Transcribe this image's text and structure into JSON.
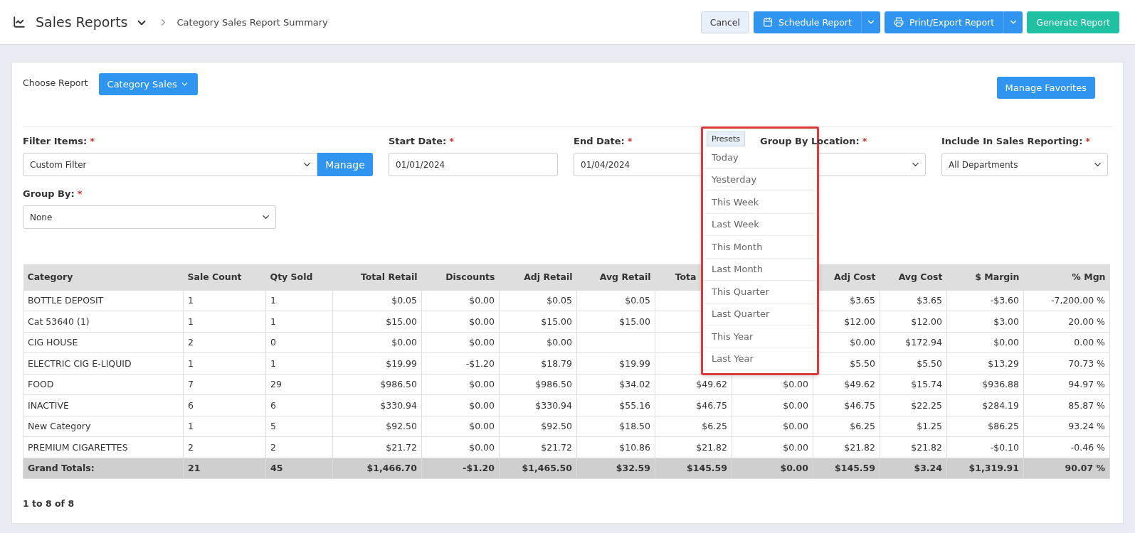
{
  "header": {
    "title": "Sales Reports",
    "breadcrumb": "Category Sales Report Summary",
    "cancel_button": "Cancel",
    "schedule_button": "Schedule Report",
    "export_button": "Print/Export Report",
    "generate_button": "Generate Report"
  },
  "choose_report": {
    "label": "Choose Report",
    "value": "Category Sales",
    "favorites_button": "Manage Favorites"
  },
  "filters": [
    {
      "kind": "select-manage",
      "label": "Filter Items:",
      "mark": "*",
      "value": "Custom Filter",
      "button": "Manage"
    },
    {
      "kind": "date",
      "label": "Start Date:",
      "mark": "*",
      "value": "01/01/2024"
    },
    {
      "kind": "date",
      "label": "End Date:",
      "mark": "*",
      "value": "01/04/2024"
    },
    {
      "kind": "select",
      "label": "Group By Location:",
      "mark": "*"
    },
    {
      "kind": "select",
      "label": "Include In Sales Reporting:",
      "mark": "*",
      "value": "All Departments"
    }
  ],
  "group_by": {
    "label": "Group By:",
    "mark": "*",
    "value": "None"
  },
  "presets": {
    "tag": "Presets",
    "items": [
      "Today",
      "Yesterday",
      "This Week",
      "Last Week",
      "This Month",
      "Last Month",
      "This Quarter",
      "Last Quarter",
      "This Year",
      "Last Year"
    ]
  },
  "table": {
    "columns": [
      "Category",
      "Sale Count",
      "Qty Sold",
      "Total Retail",
      "Discounts",
      "Adj Retail",
      "Avg Retail",
      "Tota",
      null,
      "Adj Cost",
      "Avg Cost",
      "$ Margin",
      "% Mgn"
    ],
    "rows": [
      {
        "cells": [
          "BOTTLE DEPOSIT",
          "1",
          "1",
          "$0.05",
          "$0.00",
          "$0.05",
          "$0.05",
          null,
          null,
          "$3.65",
          "$3.65",
          "-$3.60",
          "-7,200.00 %"
        ]
      },
      {
        "cells": [
          "Cat 53640 (1)",
          "1",
          "1",
          "$15.00",
          "$0.00",
          "$15.00",
          "$15.00",
          null,
          null,
          "$12.00",
          "$12.00",
          "$3.00",
          "20.00 %"
        ]
      },
      {
        "cells": [
          "CIG HOUSE",
          "2",
          "0",
          "$0.00",
          "$0.00",
          "$0.00",
          null,
          null,
          null,
          "$0.00",
          "$172.94",
          "$0.00",
          "0.00 %"
        ]
      },
      {
        "cells": [
          "ELECTRIC CIG E-LIQUID",
          "1",
          "1",
          "$19.99",
          "-$1.20",
          "$18.79",
          "$19.99",
          null,
          null,
          "$5.50",
          "$5.50",
          "$13.29",
          "70.73 %"
        ]
      },
      {
        "cells": [
          "FOOD",
          "7",
          "29",
          "$986.50",
          "$0.00",
          "$986.50",
          "$34.02",
          "$49.62",
          "$0.00",
          "$49.62",
          "$15.74",
          "$936.88",
          "94.97 %"
        ]
      },
      {
        "cells": [
          "INACTIVE",
          "6",
          "6",
          "$330.94",
          "$0.00",
          "$330.94",
          "$55.16",
          "$46.75",
          "$0.00",
          "$46.75",
          "$22.25",
          "$284.19",
          "85.87 %"
        ]
      },
      {
        "cells": [
          "New Category",
          "1",
          "5",
          "$92.50",
          "$0.00",
          "$92.50",
          "$18.50",
          "$6.25",
          "$0.00",
          "$6.25",
          "$1.25",
          "$86.25",
          "93.24 %"
        ]
      },
      {
        "cells": [
          "PREMIUM CIGARETTES",
          "2",
          "2",
          "$21.72",
          "$0.00",
          "$21.72",
          "$10.86",
          "$21.82",
          "$0.00",
          "$21.82",
          "$21.82",
          "-$0.10",
          "-0.46 %"
        ]
      }
    ],
    "totals": [
      "Grand Totals:",
      "21",
      "45",
      "$1,466.70",
      "-$1.20",
      "$1,465.50",
      "$32.59",
      "$145.59",
      "$0.00",
      "$145.59",
      "$3.24",
      "$1,319.91",
      "90.07 %"
    ]
  },
  "pager": "1 to 8 of 8"
}
